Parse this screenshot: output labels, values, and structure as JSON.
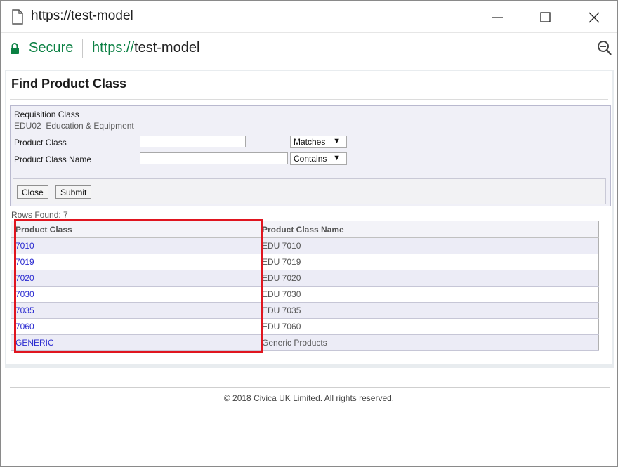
{
  "window": {
    "title": "https://test-model",
    "controls": [
      "minimize",
      "maximize",
      "close"
    ]
  },
  "addressbar": {
    "secure_label": "Secure",
    "url_scheme": "https://",
    "url_host": "test-model"
  },
  "page": {
    "title": "Find Product Class",
    "requisition_class_label": "Requisition Class",
    "requisition_class_value": "EDU02  Education & Equipment",
    "product_class_label": "Product Class",
    "product_class_value": "",
    "product_class_operator": "Matches",
    "product_class_name_label": "Product Class Name",
    "product_class_name_value": "",
    "product_class_name_operator": "Contains",
    "close_button": "Close",
    "submit_button": "Submit",
    "rows_found": "Rows Found: 7"
  },
  "table": {
    "headers": [
      "Product Class",
      "Product Class Name"
    ],
    "rows": [
      {
        "code": "7010",
        "name": "EDU 7010"
      },
      {
        "code": "7019",
        "name": "EDU 7019"
      },
      {
        "code": "7020",
        "name": "EDU 7020"
      },
      {
        "code": "7030",
        "name": "EDU 7030"
      },
      {
        "code": "7035",
        "name": "EDU 7035"
      },
      {
        "code": "7060",
        "name": "EDU 7060"
      },
      {
        "code": "GENERIC",
        "name": "Generic Products"
      }
    ]
  },
  "footer": {
    "copyright": "© 2018 Civica UK Limited. All rights reserved."
  },
  "colors": {
    "secure_green": "#0b8043",
    "link_blue": "#2a2ad0",
    "highlight_red": "#e0151f",
    "row_alt": "#ececf6"
  }
}
